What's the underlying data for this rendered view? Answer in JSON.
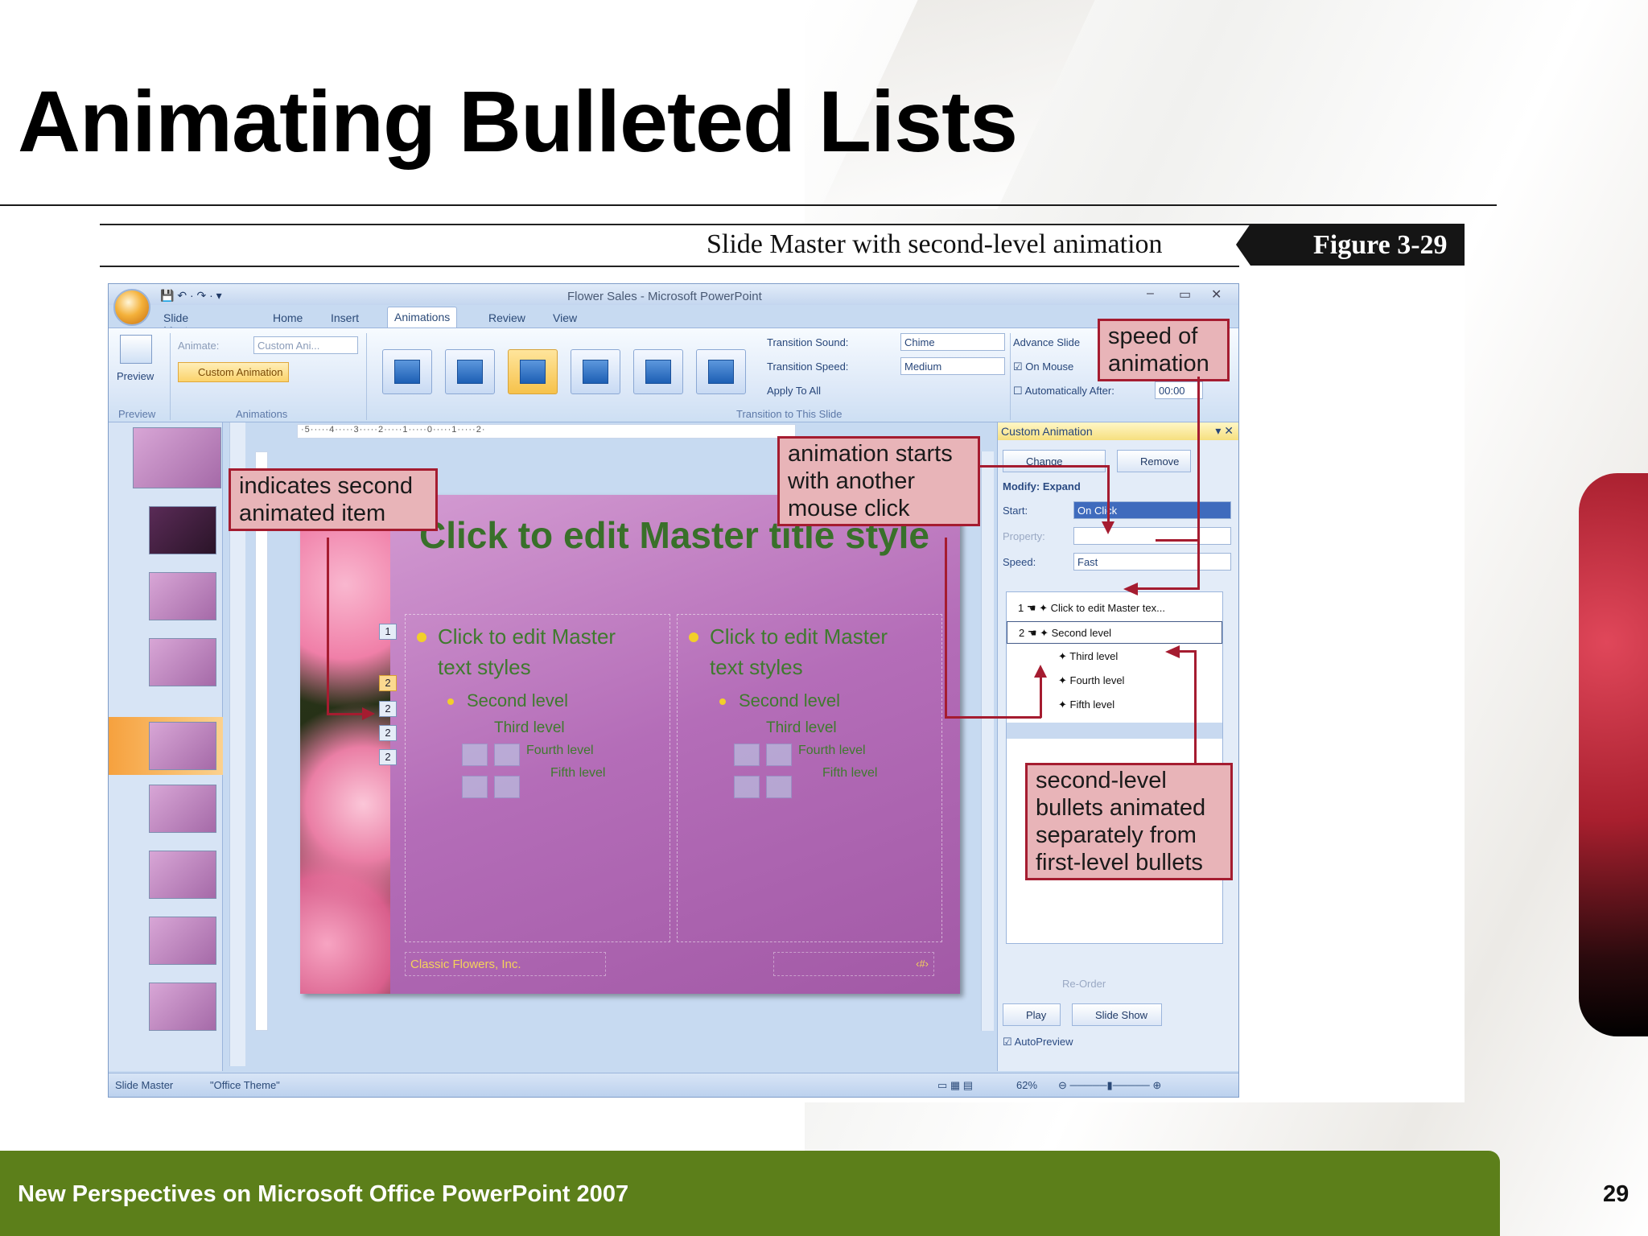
{
  "slide": {
    "title": "Animating Bulleted Lists",
    "footer": "New Perspectives on Microsoft Office PowerPoint 2007",
    "page_number": "29"
  },
  "figure": {
    "caption": "Slide Master with second-level animation",
    "label": "Figure  3-29"
  },
  "app": {
    "window_title": "Flower Sales - Microsoft PowerPoint",
    "tabs": [
      "Slide Master",
      "Home",
      "Insert",
      "Animations",
      "Review",
      "View"
    ],
    "active_tab": "Animations",
    "ribbon": {
      "preview_label": "Preview",
      "preview_group": "Preview",
      "animate_label": "Animate:",
      "animate_value": "Custom Ani...",
      "custom_animation_label": "Custom Animation",
      "animations_group": "Animations",
      "transition_sound_label": "Transition Sound:",
      "transition_sound_value": "Chime",
      "transition_speed_label": "Transition Speed:",
      "transition_speed_value": "Medium",
      "apply_to_all_label": "Apply To All",
      "transition_group": "Transition to This Slide",
      "advance_slide_label": "Advance Slide",
      "on_mouse_label": "On Mouse",
      "auto_after_label": "Automatically After:",
      "auto_after_value": "00:00"
    },
    "slide_content": {
      "title": "Click to edit Master title style",
      "level1": "Click to edit Master text styles",
      "level2": "Second level",
      "level3": "Third level",
      "level4": "Fourth level",
      "level5": "Fifth level",
      "footer_text": "Classic Flowers, Inc.",
      "number_placeholder": "‹#›"
    },
    "anim_tags": [
      "1",
      "2",
      "2",
      "2",
      "2"
    ],
    "custom_animation_pane": {
      "title": "Custom Animation",
      "change_label": "Change",
      "remove_label": "Remove",
      "modify_label": "Modify: Expand",
      "start_label": "Start:",
      "start_value": "On Click",
      "property_label": "Property:",
      "speed_label": "Speed:",
      "speed_value": "Fast",
      "items": [
        {
          "num": "1",
          "label": "Click to edit Master tex..."
        },
        {
          "num": "2",
          "label": "Second level"
        },
        {
          "num": "",
          "label": "Third level"
        },
        {
          "num": "",
          "label": "Fourth level"
        },
        {
          "num": "",
          "label": "Fifth level"
        }
      ],
      "reorder_label": "Re-Order",
      "play_label": "Play",
      "slideshow_label": "Slide Show",
      "autopreview_label": "AutoPreview"
    },
    "status": {
      "view": "Slide Master",
      "theme": "\"Office Theme\"",
      "zoom": "62%"
    }
  },
  "callouts": {
    "speed": "speed of animation",
    "second_item": "indicates second animated item",
    "starts": "animation starts with another mouse click",
    "second_level": "second-level bullets animated separately from first-level bullets"
  },
  "colors": {
    "footer_bar": "#5c7f1a",
    "callout_fill": "#e8b4b8",
    "callout_border": "#a51c30"
  }
}
